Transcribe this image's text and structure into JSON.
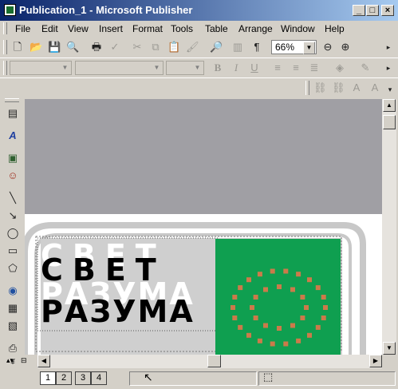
{
  "window": {
    "title": "Publication_1 - Microsoft Publisher",
    "minimize_glyph": "_",
    "maximize_glyph": "□",
    "close_glyph": "×"
  },
  "menu": {
    "items": [
      "File",
      "Edit",
      "View",
      "Insert",
      "Format",
      "Tools",
      "Table",
      "Arrange",
      "Window",
      "Help"
    ]
  },
  "standard_toolbar": {
    "zoom_value": "66%"
  },
  "publication": {
    "title_line1": "СВЕТ",
    "title_line2": "РАЗУМА",
    "image_color": "#0f9f50",
    "dot_color": "#cc7a4a"
  },
  "status": {
    "pages": [
      "1",
      "2",
      "3",
      "4"
    ],
    "current_page": "1"
  }
}
